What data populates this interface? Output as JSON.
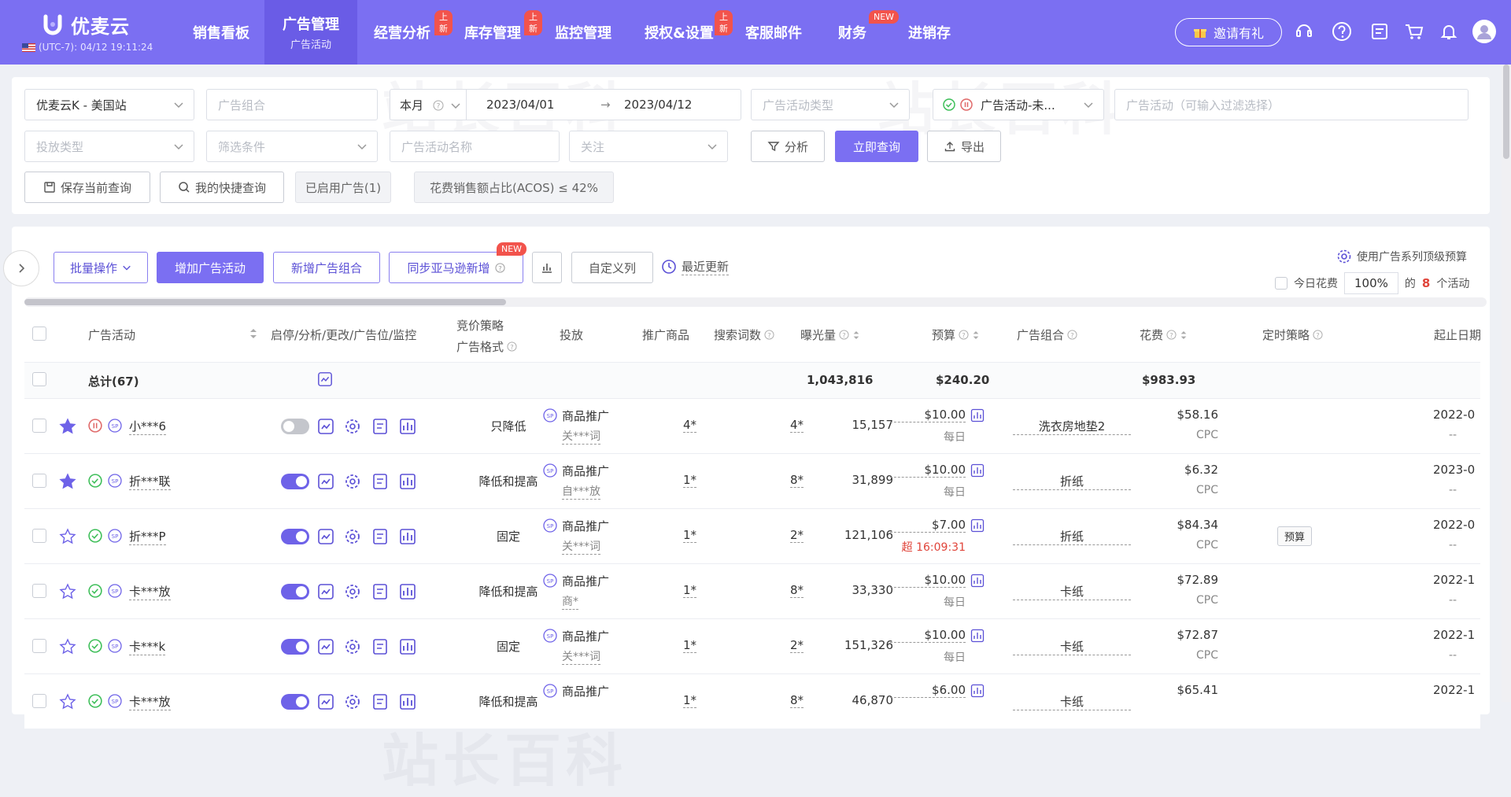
{
  "app": {
    "name": "优麦云",
    "clock": "(UTC-7): 04/12 19:11:24"
  },
  "nav": [
    {
      "label": "销售看板",
      "sub": "",
      "badge": ""
    },
    {
      "label": "广告管理",
      "sub": "广告活动",
      "badge": ""
    },
    {
      "label": "经营分析",
      "sub": "",
      "badge": "上新"
    },
    {
      "label": "库存管理",
      "sub": "",
      "badge": "上新"
    },
    {
      "label": "监控管理",
      "sub": "",
      "badge": ""
    },
    {
      "label": "授权&设置",
      "sub": "",
      "badge": "上新"
    },
    {
      "label": "客服邮件",
      "sub": "",
      "badge": ""
    },
    {
      "label": "财务",
      "sub": "",
      "badge": "NEW"
    },
    {
      "label": "进销存",
      "sub": "",
      "badge": ""
    }
  ],
  "header": {
    "invite": "邀请有礼",
    "icons": [
      "support-icon",
      "help-icon",
      "message-icon",
      "cart-icon",
      "bell-icon",
      "avatar"
    ]
  },
  "filters": {
    "store": "优麦云K - 美国站",
    "ad_group_ph": "广告组合",
    "period": "本月",
    "date_start": "2023/04/01",
    "date_arrow": "→",
    "date_end": "2023/04/12",
    "campaign_type_ph": "广告活动类型",
    "status": "广告活动-未...",
    "campaign_ph": "广告活动（可输入过滤选择）",
    "delivery_type_ph": "投放类型",
    "condition_ph": "筛选条件",
    "campaign_name_ph": "广告活动名称",
    "follow_ph": "关注",
    "analyze": "分析",
    "query": "立即查询",
    "export": "导出",
    "save_query": "保存当前查询",
    "my_query": "我的快捷查询",
    "tag_enabled": "已启用广告(1)",
    "tag_acos": "花费销售额占比(ACOS) ≤ 42%"
  },
  "toolbar": {
    "batch": "批量操作",
    "add_campaign": "增加广告活动",
    "add_group": "新增广告组合",
    "sync": "同步亚马逊新增",
    "sync_badge": "NEW",
    "custom_cols": "自定义列",
    "recent_update": "最近更新",
    "budget_setting": "使用广告系列顶级预算",
    "today_spend": "今日花费",
    "percent": "100%",
    "of": "的",
    "count": "8",
    "count_suffix": "个活动"
  },
  "columns": {
    "campaign": "广告活动",
    "actions": "启停/分析/更改/广告位/监控",
    "bid_strategy": "竞价策略",
    "ad_format": "广告格式",
    "delivery": "投放",
    "products": "推广商品",
    "keywords": "搜索词数",
    "impressions": "曝光量",
    "budget": "预算",
    "group": "广告组合",
    "spend": "花费",
    "schedule": "定时策略",
    "dates": "起止日期"
  },
  "total": {
    "label": "总计(67)",
    "impressions": "1,043,816",
    "budget": "$240.20",
    "spend": "$983.93"
  },
  "rows": [
    {
      "starred": true,
      "status": "paused",
      "name": "小***6",
      "on": false,
      "bid": "只降低",
      "delivery": "商品推广",
      "delivery_sub": "关***词",
      "products": "4*",
      "keywords": "4*",
      "impressions": "15,157",
      "budget": "$10.00",
      "budget_sub": "每日",
      "group": "洗衣房地垫2",
      "spend": "$58.16",
      "spend_sub": "CPC",
      "schedule": "",
      "date": "2022-0",
      "date_sub": "--"
    },
    {
      "starred": true,
      "status": "active",
      "name": "折***联",
      "on": true,
      "bid": "降低和提高",
      "delivery": "商品推广",
      "delivery_sub": "自***放",
      "products": "1*",
      "keywords": "8*",
      "impressions": "31,899",
      "budget": "$10.00",
      "budget_sub": "每日",
      "group": "折纸",
      "spend": "$6.32",
      "spend_sub": "CPC",
      "schedule": "",
      "date": "2023-0",
      "date_sub": "--"
    },
    {
      "starred": false,
      "status": "active",
      "name": "折***P",
      "on": true,
      "bid": "固定",
      "delivery": "商品推广",
      "delivery_sub": "关***词",
      "products": "1*",
      "keywords": "2*",
      "impressions": "121,106",
      "budget": "$7.00",
      "budget_sub": "超 16:09:31",
      "group": "折纸",
      "spend": "$84.34",
      "spend_sub": "CPC",
      "schedule": "预算",
      "date": "2022-0",
      "date_sub": "--"
    },
    {
      "starred": false,
      "status": "active",
      "name": "卡***放",
      "on": true,
      "bid": "降低和提高",
      "delivery": "商品推广",
      "delivery_sub": "商*",
      "products": "1*",
      "keywords": "8*",
      "impressions": "33,330",
      "budget": "$10.00",
      "budget_sub": "每日",
      "group": "卡纸",
      "spend": "$72.89",
      "spend_sub": "CPC",
      "schedule": "",
      "date": "2022-1",
      "date_sub": "--"
    },
    {
      "starred": false,
      "status": "active",
      "name": "卡***k",
      "on": true,
      "bid": "固定",
      "delivery": "商品推广",
      "delivery_sub": "关***词",
      "products": "1*",
      "keywords": "2*",
      "impressions": "151,326",
      "budget": "$10.00",
      "budget_sub": "每日",
      "group": "卡纸",
      "spend": "$72.87",
      "spend_sub": "CPC",
      "schedule": "",
      "date": "2022-1",
      "date_sub": "--"
    },
    {
      "starred": false,
      "status": "active",
      "name": "卡***放",
      "on": true,
      "bid": "降低和提高",
      "delivery": "商品推广",
      "delivery_sub": "",
      "products": "1*",
      "keywords": "8*",
      "impressions": "46,870",
      "budget": "$6.00",
      "budget_sub": "",
      "group": "卡纸",
      "spend": "$65.41",
      "spend_sub": "",
      "schedule": "",
      "date": "2022-1",
      "date_sub": ""
    }
  ],
  "colors": {
    "brand": "#7b6ff2",
    "badge": "#f2534c",
    "over_budget": "#e0443a",
    "active": "#3fbf5a",
    "paused": "#e06a6a"
  }
}
